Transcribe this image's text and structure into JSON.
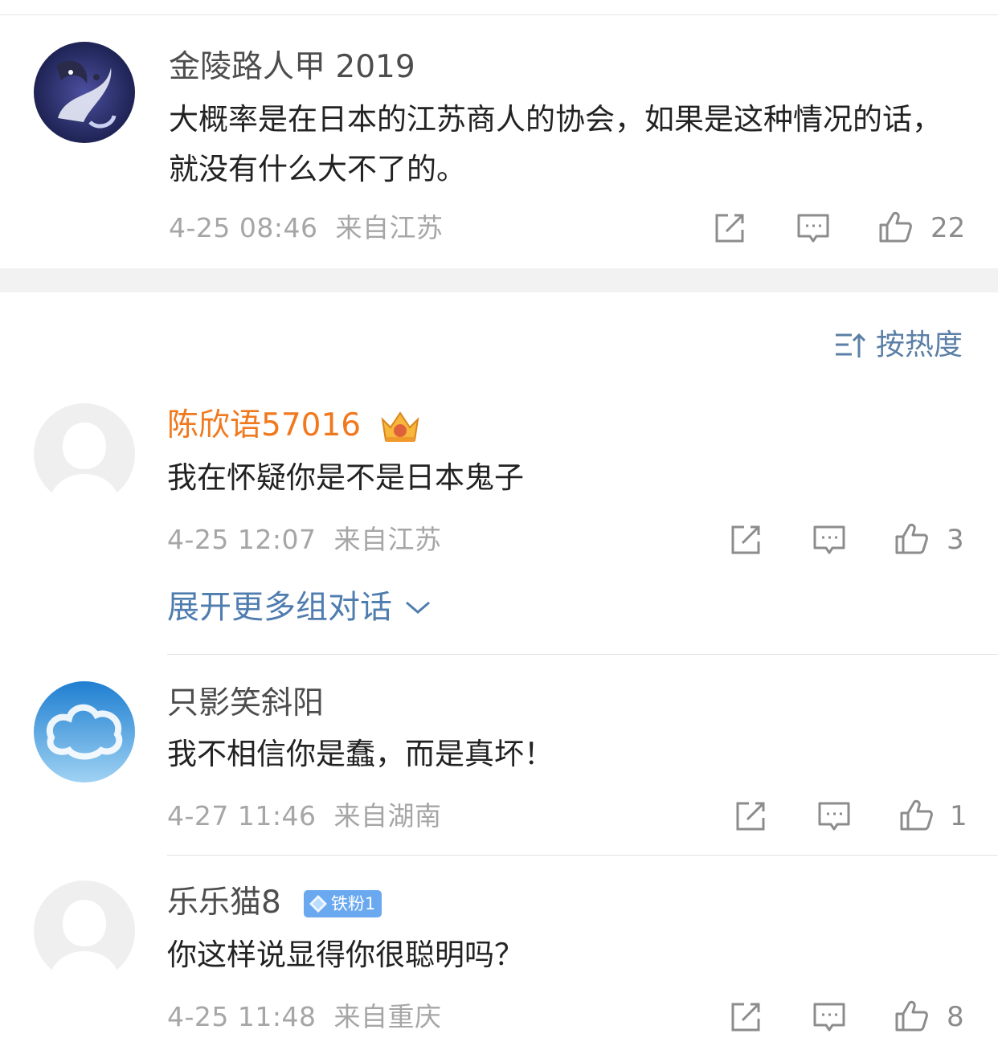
{
  "top_comment": {
    "username": "金陵路人甲 2019",
    "text": "大概率是在日本的江苏商人的协会，如果是这种情况的话，就没有什么大不了的。",
    "date": "4-25 08:46",
    "location": "来自江苏",
    "likes": "22",
    "avatar_icon": "koi-fish-avatar"
  },
  "sort": {
    "label": "按热度",
    "icon": "sort-icon"
  },
  "comments": [
    {
      "username": "陈欣语57016",
      "username_color": "#f0791e",
      "badge_icon": "vip-crown-icon",
      "text": "我在怀疑你是不是日本鬼子",
      "date": "4-25 12:07",
      "location": "来自江苏",
      "likes": "3"
    },
    {
      "username": "只影笑斜阳",
      "text": "我不相信你是蠢，而是真坏！",
      "date": "4-27 11:46",
      "location": "来自湖南",
      "likes": "1"
    },
    {
      "username": "乐乐猫8",
      "fan_badge": "铁粉1",
      "text": "你这样说显得你很聪明吗？",
      "date": "4-25 11:48",
      "location": "来自重庆",
      "likes": "8"
    }
  ],
  "expand": {
    "label": "展开更多组对话"
  },
  "colors": {
    "accent_link": "#507daf",
    "vip_name": "#f0791e",
    "meta_gray": "#a6a6a6",
    "fan_badge_bg": "#6aa9f0"
  }
}
